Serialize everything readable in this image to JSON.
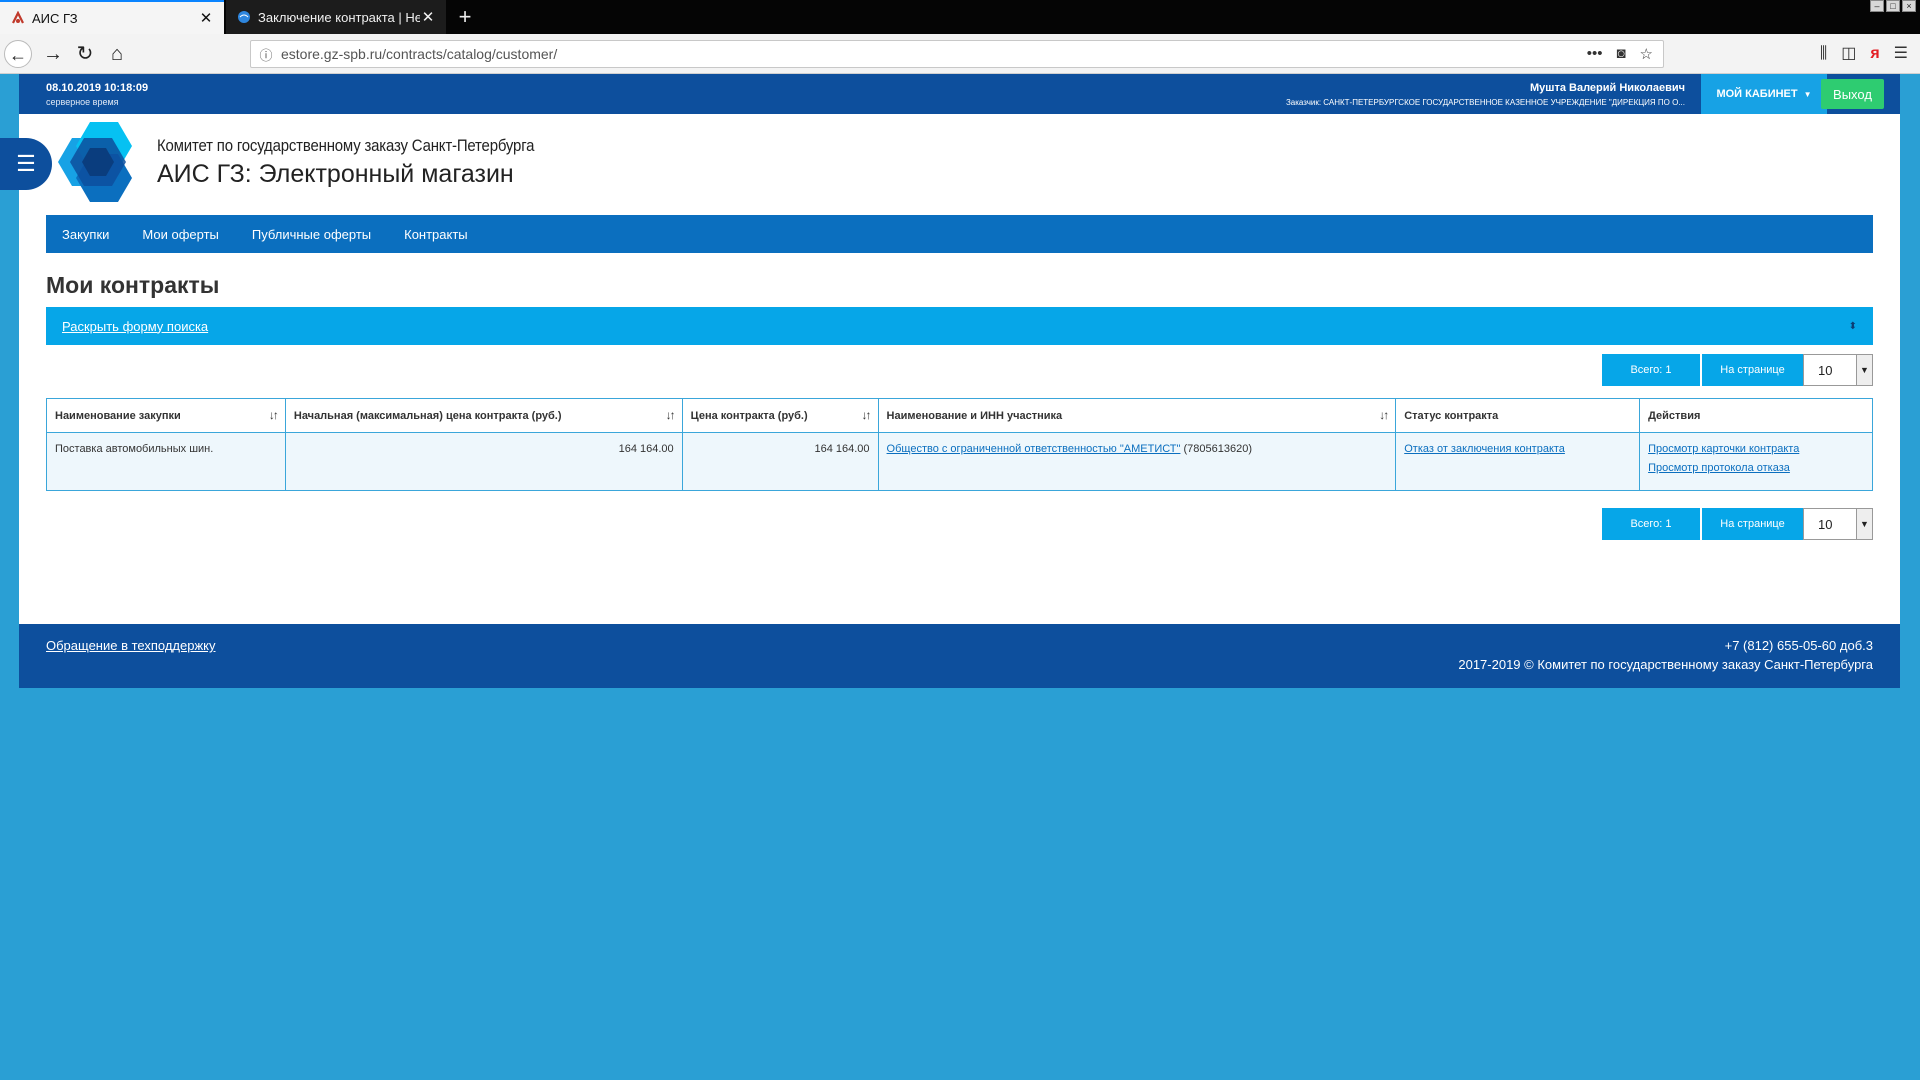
{
  "browser": {
    "tabs": [
      {
        "title": "АИС ГЗ",
        "active": true
      },
      {
        "title": "Заключение контракта | Help",
        "active": false
      }
    ],
    "url": "estore.gz-spb.ru/contracts/catalog/customer/"
  },
  "header": {
    "server_time": "08.10.2019 10:18:09",
    "server_time_label": "серверное время",
    "user_name": "Мушта Валерий Николаевич",
    "customer": "Заказчик: САНКТ-ПЕТЕРБУРГСКОЕ ГОСУДАРСТВЕННОЕ КАЗЕННОЕ УЧРЕЖДЕНИЕ \"ДИРЕКЦИЯ ПО О...",
    "cabinet_label": "МОЙ КАБИНЕТ",
    "logout_label": "Выход"
  },
  "brand": {
    "org_name": "Комитет по государственному заказу Санкт-Петербурга",
    "app_name": "АИС ГЗ: Электронный магазин"
  },
  "nav": {
    "items": [
      "Закупки",
      "Мои оферты",
      "Публичные оферты",
      "Контракты"
    ]
  },
  "main": {
    "title": "Мои контракты",
    "search_toggle": "Раскрыть форму поиска",
    "pager": {
      "total": "Всего: 1",
      "per_page_label": "На странице",
      "per_page_value": "10"
    },
    "table": {
      "columns": [
        "Наименование закупки",
        "Начальная (максимальная) цена контракта (руб.)",
        "Цена контракта (руб.)",
        "Наименование и ИНН участника",
        "Статус контракта",
        "Действия"
      ],
      "rows": [
        {
          "purchase": "Поставка автомобильных шин.",
          "max_price": "164 164.00",
          "price": "164 164.00",
          "participant_name": "Общество с ограниченной ответственностью \"АМЕТИСТ\"",
          "participant_inn": "(7805613620)",
          "status": "Отказ от заключения контракта",
          "actions": [
            "Просмотр карточки контракта",
            "Просмотр протокола отказа"
          ]
        }
      ]
    }
  },
  "footer": {
    "support_link": "Обращение в техподдержку",
    "phone": "+7 (812) 655-05-60 доб.3",
    "copyright": "2017-2019 © Комитет по государственному заказу Санкт-Петербурга"
  },
  "colors": {
    "brand_dark": "#0d4f9d",
    "brand_nav": "#0b6fbf",
    "accent": "#06a6e8",
    "logout": "#2ecc71",
    "background": "#2a9fd4"
  }
}
